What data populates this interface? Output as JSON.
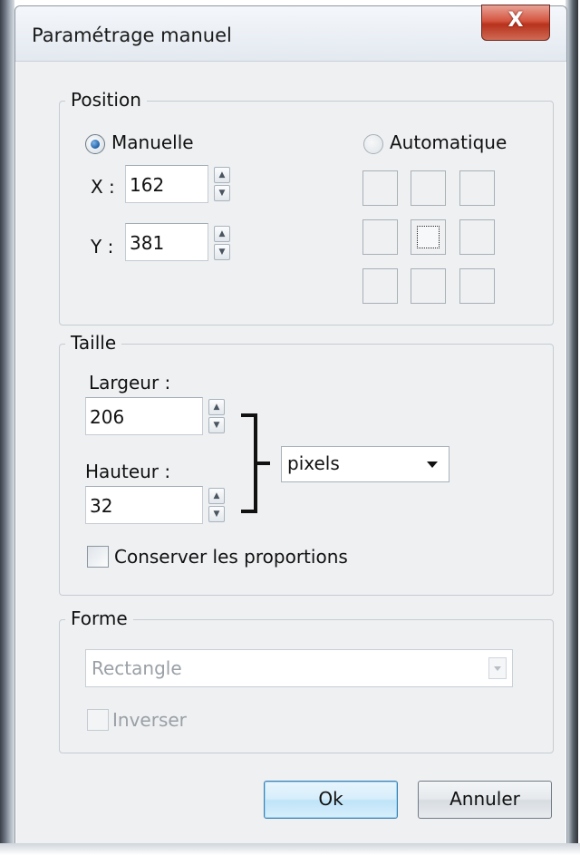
{
  "window": {
    "title": "Paramétrage manuel",
    "close_glyph": "X"
  },
  "position": {
    "legend": "Position",
    "manual_label": "Manuelle",
    "automatic_label": "Automatique",
    "x_label": "X :",
    "x_value": "162",
    "y_label": "Y :",
    "y_value": "381"
  },
  "taille": {
    "legend": "Taille",
    "width_label": "Largeur :",
    "width_value": "206",
    "height_label": "Hauteur :",
    "height_value": "32",
    "unit_selected": "pixels",
    "keep_proportions_label": "Conserver les proportions"
  },
  "forme": {
    "legend": "Forme",
    "shape_selected": "Rectangle",
    "invert_label": "Inverser"
  },
  "buttons": {
    "ok": "Ok",
    "cancel": "Annuler"
  },
  "icons": {
    "spin_up": "▲",
    "spin_down": "▼"
  }
}
